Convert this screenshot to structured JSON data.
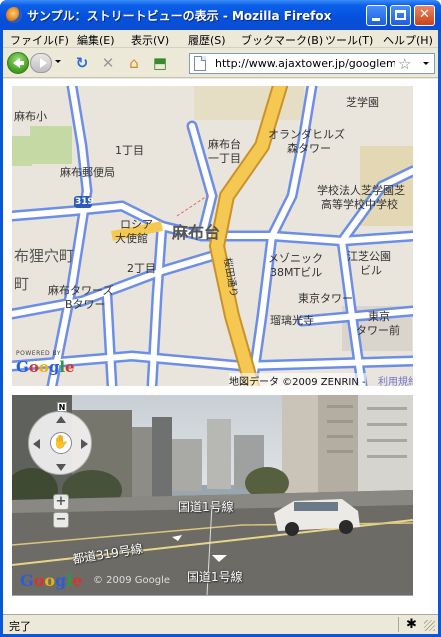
{
  "window": {
    "title": "サンプル：ストリートビューの表示 - Mozilla Firefox"
  },
  "menu": {
    "items": [
      "ファイル(F)",
      "編集(E)",
      "表示(V)",
      "履歴(S)",
      "ブックマーク(B)",
      "ツール(T)",
      "ヘルプ(H)"
    ]
  },
  "navbar": {
    "url": "http://www.ajaxtower.jp/googlemaps/"
  },
  "map": {
    "labels": [
      "麻布小",
      "1丁目",
      "麻布郵便局",
      "ロシア",
      "大使館",
      "麻布台",
      "2丁目",
      "布狸穴町",
      "町",
      "麻布タワーズ",
      "Bタワー",
      "麻布台",
      "一丁目",
      "オランダヒルズ",
      "森タワー",
      "芝学園",
      "学校法人芝学園芝",
      "高等学校中学校",
      "メゾニック",
      "38MTビル",
      "江芝公園",
      "ビル",
      "東京タワー",
      "瑠璃光寺",
      "東京",
      "タワー前",
      "桜田通り",
      "319"
    ],
    "powered_by": "POWERED BY",
    "logo": "Google",
    "copyright": "地図データ ©2009 ZENRIN -",
    "terms": "利用規約"
  },
  "streetview": {
    "compass_n": "N",
    "zoom_in": "+",
    "zoom_out": "−",
    "road_labels": [
      "国道1号線",
      "都道319号線",
      "国道1号線"
    ],
    "logo": "Google",
    "copyright": "© 2009 Google"
  },
  "status": {
    "text": "完了"
  },
  "colors": {
    "titlebar": "#0550dc",
    "chrome": "#ece9d8",
    "map_bg": "#e9e5dc",
    "road": "#a9bdf0",
    "highway": "#f5c851"
  }
}
